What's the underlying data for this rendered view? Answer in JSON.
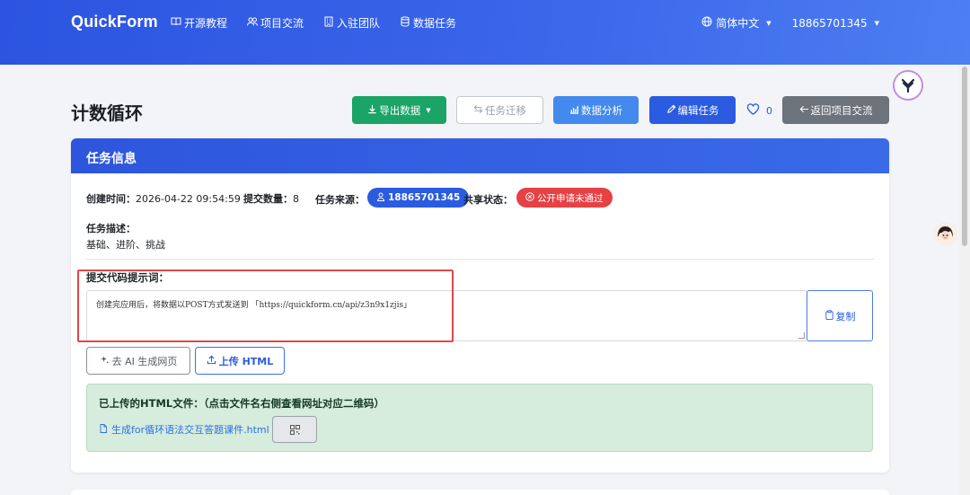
{
  "nav": {
    "brand": "QuickForm",
    "links": [
      {
        "label": "开源教程",
        "icon": "book-icon"
      },
      {
        "label": "项目交流",
        "icon": "users-icon"
      },
      {
        "label": "入驻团队",
        "icon": "building-icon"
      },
      {
        "label": "数据任务",
        "icon": "database-icon"
      }
    ],
    "language": "简体中文",
    "user": "18865701345"
  },
  "page": {
    "title": "计数循环",
    "buttons": {
      "export": "导出数据",
      "migrate": "任务迁移",
      "analysis": "数据分析",
      "edit": "编辑任务",
      "back": "返回项目交流"
    },
    "likes": "0"
  },
  "card": {
    "header": "任务信息",
    "created_label": "创建时间：",
    "created_value": "2026-04-22 09:54:59",
    "count_label": "提交数量：",
    "count_value": "8",
    "source_label": "任务来源：",
    "source_value": "18865701345",
    "share_label": "共享状态：",
    "share_value": "公开申请未通过",
    "desc_label": "任务描述：",
    "desc_value": "基础、进阶、挑战",
    "prompt_label": "提交代码提示词：",
    "prompt_text": "创建完应用后，将数据以POST方式发送到 「https://quickform.cn/api/z3n9x1zjis」",
    "copy_label": "复制",
    "ai_button": "去 AI 生成网页",
    "upload_button": "上传 HTML",
    "uploaded_title": "已上传的HTML文件：（点击文件名右侧查看网址对应二维码）",
    "uploaded_file": "生成for循环语法交互答题课件.html"
  },
  "colors": {
    "nav_bg": "#2b54e0",
    "export_green": "#1aa466",
    "edit_blue": "#2a5be0",
    "analysis_blue": "#4389ee",
    "back_gray": "#6c737b",
    "share_red": "#e64144",
    "highlight_red": "#e0474a",
    "uploaded_bg": "#d6ecdc"
  }
}
